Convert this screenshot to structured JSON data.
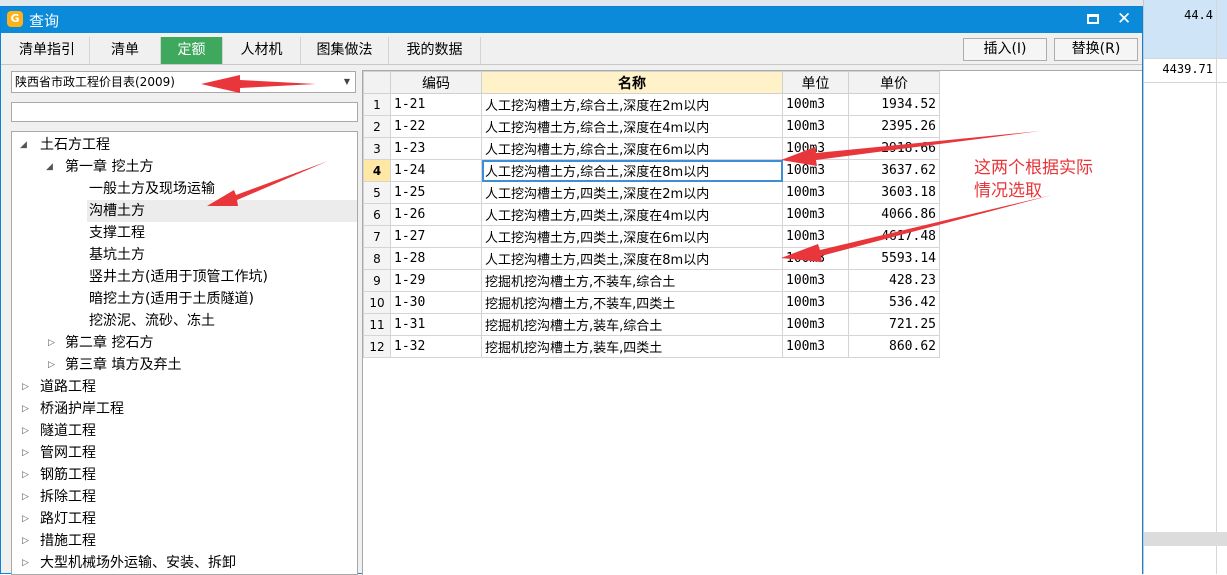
{
  "background": {
    "cell_top": "44.4",
    "cell_mid": "4439.71"
  },
  "window": {
    "title": "查询",
    "icon": "app-logo-icon"
  },
  "tabs": [
    {
      "label": "清单指引",
      "active": false
    },
    {
      "label": "清单",
      "active": false
    },
    {
      "label": "定额",
      "active": true
    },
    {
      "label": "人材机",
      "active": false
    },
    {
      "label": "图集做法",
      "active": false
    },
    {
      "label": "我的数据",
      "active": false
    }
  ],
  "toolbar": {
    "insert_label": "插入(I)",
    "replace_label": "替换(R)"
  },
  "library": {
    "selected": "陕西省市政工程价目表(2009)",
    "filter_value": ""
  },
  "tree": [
    {
      "label": "土石方工程",
      "expanded": true
    },
    {
      "label": "第一章 挖土方",
      "expanded": true
    },
    {
      "label": "一般土方及现场运输"
    },
    {
      "label": "沟槽土方",
      "selected": true
    },
    {
      "label": "支撑工程"
    },
    {
      "label": "基坑土方"
    },
    {
      "label": "竖井土方(适用于顶管工作坑)"
    },
    {
      "label": "暗挖土方(适用于土质隧道)"
    },
    {
      "label": "挖淤泥、流砂、冻土"
    },
    {
      "label": "第二章 挖石方",
      "expanded": false
    },
    {
      "label": "第三章 填方及弃土",
      "expanded": false
    },
    {
      "label": "道路工程",
      "expanded": false
    },
    {
      "label": "桥涵护岸工程",
      "expanded": false
    },
    {
      "label": "隧道工程",
      "expanded": false
    },
    {
      "label": "管网工程",
      "expanded": false
    },
    {
      "label": "钢筋工程",
      "expanded": false
    },
    {
      "label": "拆除工程",
      "expanded": false
    },
    {
      "label": "路灯工程",
      "expanded": false
    },
    {
      "label": "措施工程",
      "expanded": false
    },
    {
      "label": "大型机械场外运输、安装、拆卸",
      "expanded": false
    }
  ],
  "grid": {
    "headers": {
      "code": "编码",
      "name": "名称",
      "unit": "单位",
      "price": "单价"
    },
    "rows": [
      {
        "n": "1",
        "code": "1-21",
        "name": "人工挖沟槽土方,综合土,深度在2m以内",
        "unit": "100m3",
        "price": "1934.52"
      },
      {
        "n": "2",
        "code": "1-22",
        "name": "人工挖沟槽土方,综合土,深度在4m以内",
        "unit": "100m3",
        "price": "2395.26"
      },
      {
        "n": "3",
        "code": "1-23",
        "name": "人工挖沟槽土方,综合土,深度在6m以内",
        "unit": "100m3",
        "price": "2918.66"
      },
      {
        "n": "4",
        "code": "1-24",
        "name": "人工挖沟槽土方,综合土,深度在8m以内",
        "unit": "100m3",
        "price": "3637.62",
        "current": true
      },
      {
        "n": "5",
        "code": "1-25",
        "name": "人工挖沟槽土方,四类土,深度在2m以内",
        "unit": "100m3",
        "price": "3603.18"
      },
      {
        "n": "6",
        "code": "1-26",
        "name": "人工挖沟槽土方,四类土,深度在4m以内",
        "unit": "100m3",
        "price": "4066.86"
      },
      {
        "n": "7",
        "code": "1-27",
        "name": "人工挖沟槽土方,四类土,深度在6m以内",
        "unit": "100m3",
        "price": "4617.48"
      },
      {
        "n": "8",
        "code": "1-28",
        "name": "人工挖沟槽土方,四类土,深度在8m以内",
        "unit": "100m3",
        "price": "5593.14"
      },
      {
        "n": "9",
        "code": "1-29",
        "name": "挖掘机挖沟槽土方,不装车,综合土",
        "unit": "100m3",
        "price": "428.23"
      },
      {
        "n": "10",
        "code": "1-30",
        "name": "挖掘机挖沟槽土方,不装车,四类土",
        "unit": "100m3",
        "price": "536.42"
      },
      {
        "n": "11",
        "code": "1-31",
        "name": "挖掘机挖沟槽土方,装车,综合土",
        "unit": "100m3",
        "price": "721.25"
      },
      {
        "n": "12",
        "code": "1-32",
        "name": "挖掘机挖沟槽土方,装车,四类土",
        "unit": "100m3",
        "price": "860.62"
      }
    ]
  },
  "annotation": {
    "line1": "这两个根据实际",
    "line2": "情况选取",
    "color": "#e8363a"
  }
}
